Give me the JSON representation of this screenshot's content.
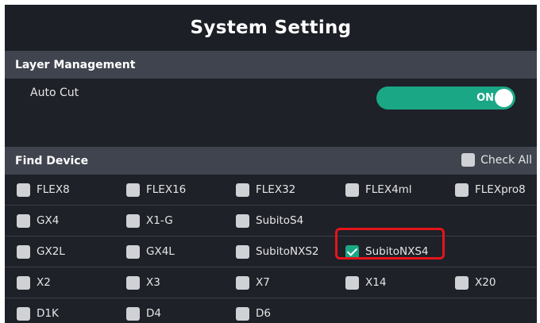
{
  "title": "System Setting",
  "layer_management": {
    "header": "Layer Management",
    "auto_cut_label": "Auto Cut",
    "auto_cut_toggle": "ON"
  },
  "find_device": {
    "header": "Find Device",
    "check_all_label": "Check All",
    "rows": [
      [
        {
          "label": "FLEX8",
          "checked": false
        },
        {
          "label": "FLEX16",
          "checked": false
        },
        {
          "label": "FLEX32",
          "checked": false
        },
        {
          "label": "FLEX4ml",
          "checked": false
        },
        {
          "label": "FLEXpro8",
          "checked": false
        }
      ],
      [
        {
          "label": "GX4",
          "checked": false
        },
        {
          "label": "X1-G",
          "checked": false
        },
        {
          "label": "SubitoS4",
          "checked": false
        }
      ],
      [
        {
          "label": "GX2L",
          "checked": false
        },
        {
          "label": "GX4L",
          "checked": false
        },
        {
          "label": "SubitoNXS2",
          "checked": false
        },
        {
          "label": "SubitoNXS4",
          "checked": true
        }
      ],
      [
        {
          "label": "X2",
          "checked": false
        },
        {
          "label": "X3",
          "checked": false
        },
        {
          "label": "X7",
          "checked": false
        },
        {
          "label": "X14",
          "checked": false
        },
        {
          "label": "X20",
          "checked": false
        }
      ],
      [
        {
          "label": "D1K",
          "checked": false
        },
        {
          "label": "D4",
          "checked": false
        },
        {
          "label": "D6",
          "checked": false
        }
      ]
    ]
  },
  "colors": {
    "accent": "#1aa785",
    "highlight": "#e5141b",
    "panel_bg": "#1e2128",
    "header_bg": "#3f444e"
  }
}
